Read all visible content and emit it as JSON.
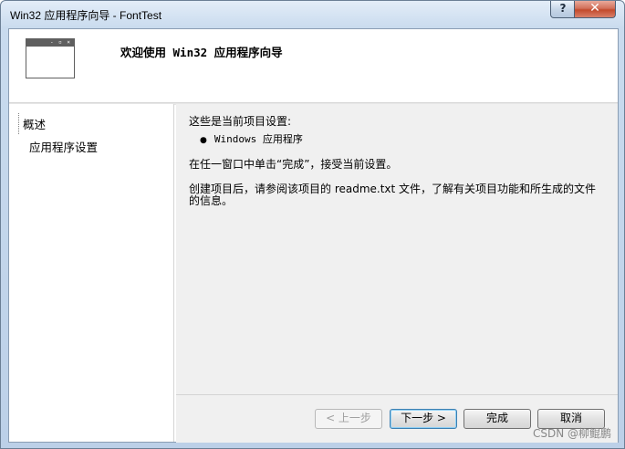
{
  "window": {
    "title": "Win32 应用程序向导 - FontTest",
    "help_label": "?",
    "close_label": "✕"
  },
  "header": {
    "title": "欢迎使用 Win32 应用程序向导",
    "icon": "window-icon",
    "icon_bar_text": "- ▫ ×"
  },
  "nav": {
    "items": [
      {
        "label": "概述",
        "selected": true
      },
      {
        "label": "应用程序设置",
        "selected": false
      }
    ]
  },
  "content": {
    "intro": "这些是当前项目设置:",
    "bullet": "Windows 应用程序",
    "instruction": "在任一窗口中单击“完成”，接受当前设置。",
    "info_line1": "创建项目后，请参阅该项目的 readme.txt 文件，了解有关项目功能和所生成的文件",
    "info_line2": "的信息。"
  },
  "buttons": {
    "prev": "< 上一步",
    "next": "下一步 >",
    "finish": "完成",
    "cancel": "取消"
  },
  "watermark": "CSDN @柳鲲鹏"
}
